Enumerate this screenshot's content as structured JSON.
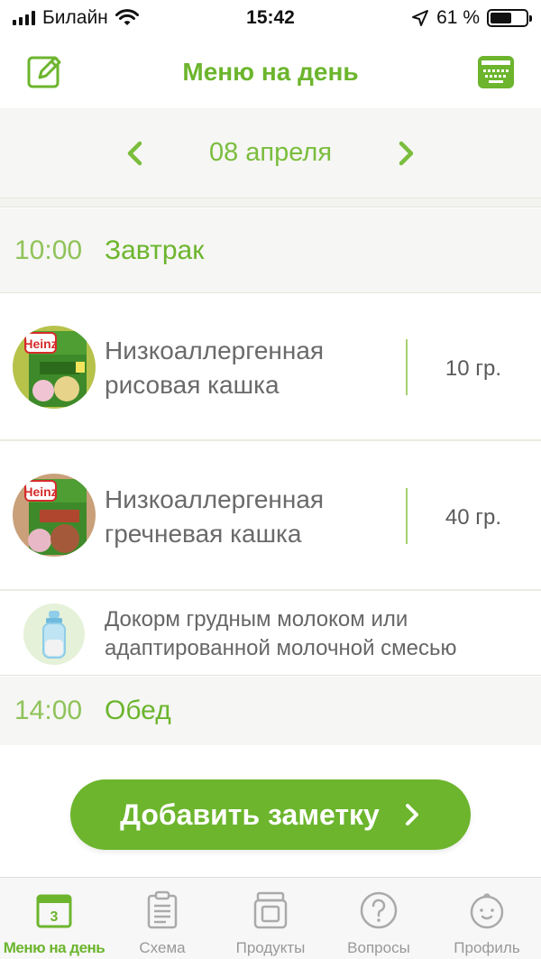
{
  "status_bar": {
    "carrier": "Билайн",
    "time": "15:42",
    "battery_text": "61 %",
    "battery_level": 0.61
  },
  "nav": {
    "title": "Меню на день",
    "left_icon": "edit-icon",
    "right_icon": "keyboard-icon"
  },
  "date_selector": {
    "date": "08 апреля",
    "prev_icon": "chevron-left-icon",
    "next_icon": "chevron-right-icon"
  },
  "meals": [
    {
      "time": "10:00",
      "name": "Завтрак",
      "items": [
        {
          "name": "Низкоаллергенная рисовая кашка",
          "amount": "10 гр.",
          "thumb_brand": "Heinz",
          "thumb_icon": "cereal-box-icon"
        },
        {
          "name": "Низкоаллергенная гречневая кашка",
          "amount": "40 гр.",
          "thumb_brand": "Heinz",
          "thumb_icon": "cereal-box-icon"
        }
      ],
      "note": {
        "text": "Докорм грудным молоком или адаптированной молочной смесью",
        "icon": "baby-bottle-icon"
      }
    },
    {
      "time": "14:00",
      "name": "Обед"
    }
  ],
  "add_note_button": {
    "label": "Добавить заметку",
    "icon": "chevron-right-icon"
  },
  "tab_bar": {
    "tabs": [
      {
        "label": "Меню на день",
        "icon": "calendar-icon",
        "badge": "3",
        "active": true
      },
      {
        "label": "Схема",
        "icon": "clipboard-icon",
        "active": false
      },
      {
        "label": "Продукты",
        "icon": "jar-icon",
        "active": false
      },
      {
        "label": "Вопросы",
        "icon": "question-icon",
        "active": false
      },
      {
        "label": "Профиль",
        "icon": "baby-face-icon",
        "active": false
      }
    ]
  },
  "colors": {
    "accent": "#6cb52d",
    "accent_light": "#8fc35a",
    "header_bg": "#f6f6f4"
  }
}
